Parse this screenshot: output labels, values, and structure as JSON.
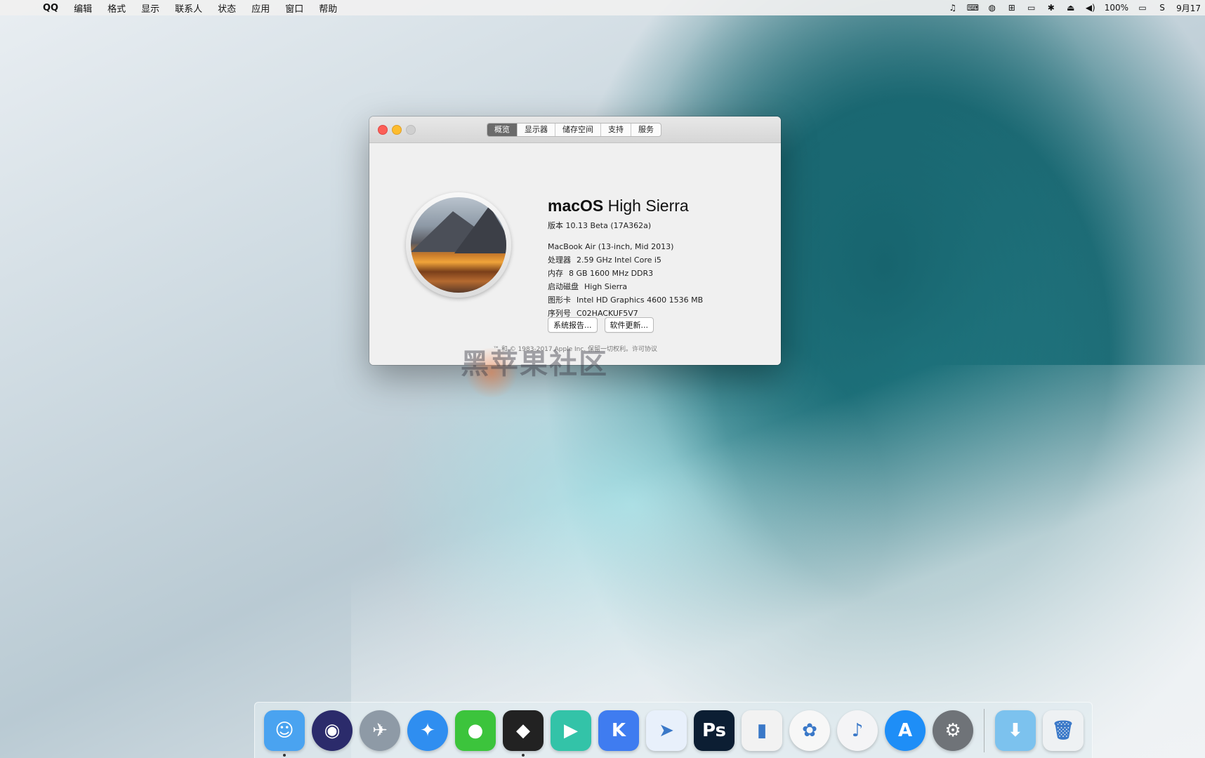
{
  "menubar": {
    "apple_icon": "apple-logo-icon",
    "items": [
      "QQ",
      "编辑",
      "格式",
      "显示",
      "联系人",
      "状态",
      "应用",
      "窗口",
      "帮助"
    ],
    "battery": "100%",
    "date": "9月17"
  },
  "window": {
    "tabs": [
      "概览",
      "显示器",
      "储存空间",
      "支持",
      "服务"
    ],
    "active_tab": "概览",
    "os_name_bold": "macOS",
    "os_name_light": " High Sierra",
    "version": "版本 10.13 Beta (17A362a)",
    "model": "MacBook Air (13-inch, Mid 2013)",
    "specs": [
      {
        "label": "处理器",
        "value": "2.59 GHz Intel Core i5"
      },
      {
        "label": "内存",
        "value": "8 GB 1600 MHz DDR3"
      },
      {
        "label": "启动磁盘",
        "value": "High Sierra"
      },
      {
        "label": "图形卡",
        "value": "Intel HD Graphics 4600 1536 MB"
      },
      {
        "label": "序列号",
        "value": "C02HACKUF5V7"
      }
    ],
    "buttons": [
      "系统报告...",
      "软件更新..."
    ],
    "footer": "™ 和 © 1983-2017 Apple Inc. 保留一切权利。许可协议"
  },
  "watermark": "黑苹果社区",
  "dock": {
    "apps": [
      {
        "name": "Finder",
        "icon": "finder-icon",
        "color": "#4aa3f0",
        "glyph": "☺",
        "running": true
      },
      {
        "name": "Siri",
        "icon": "siri-icon",
        "color": "#2b2b6b",
        "glyph": "◉",
        "running": false
      },
      {
        "name": "Launchpad",
        "icon": "launchpad-icon",
        "color": "#8e9aa6",
        "glyph": "✈",
        "running": false
      },
      {
        "name": "Safari",
        "icon": "safari-icon",
        "color": "#2f8ef0",
        "glyph": "✦",
        "running": false
      },
      {
        "name": "WeChat",
        "icon": "wechat-icon",
        "color": "#3cc43c",
        "glyph": "●",
        "running": false
      },
      {
        "name": "QQ",
        "icon": "qq-penguin-icon",
        "color": "#222222",
        "glyph": "◆",
        "running": true
      },
      {
        "name": "Video",
        "icon": "video-player-icon",
        "color": "#33c3a8",
        "glyph": "▶",
        "running": false
      },
      {
        "name": "K",
        "icon": "k-app-icon",
        "color": "#3f7cf0",
        "glyph": "K",
        "running": false
      },
      {
        "name": "Bird",
        "icon": "bird-app-icon",
        "color": "#e8f0fb",
        "glyph": "➤",
        "running": false
      },
      {
        "name": "Photoshop",
        "icon": "photoshop-icon",
        "color": "#0c1e33",
        "glyph": "Ps",
        "running": false
      },
      {
        "name": "Numbers",
        "icon": "numbers-chart-icon",
        "color": "#f2f2f2",
        "glyph": "▮",
        "running": false
      },
      {
        "name": "Photos",
        "icon": "photos-icon",
        "color": "#f7f7f7",
        "glyph": "✿",
        "running": false
      },
      {
        "name": "iTunes",
        "icon": "itunes-icon",
        "color": "#f4f4f6",
        "glyph": "♪",
        "running": false
      },
      {
        "name": "App Store",
        "icon": "app-store-icon",
        "color": "#1e8ef7",
        "glyph": "A",
        "running": false
      },
      {
        "name": "System Preferences",
        "icon": "system-preferences-icon",
        "color": "#6f7378",
        "glyph": "⚙",
        "running": false
      }
    ],
    "stack": {
      "name": "Downloads",
      "icon": "downloads-folder-icon",
      "color": "#7cc2ee",
      "glyph": "⬇"
    },
    "trash": {
      "name": "Trash",
      "icon": "trash-icon",
      "color": "#eef1f3",
      "glyph": "🗑"
    }
  }
}
